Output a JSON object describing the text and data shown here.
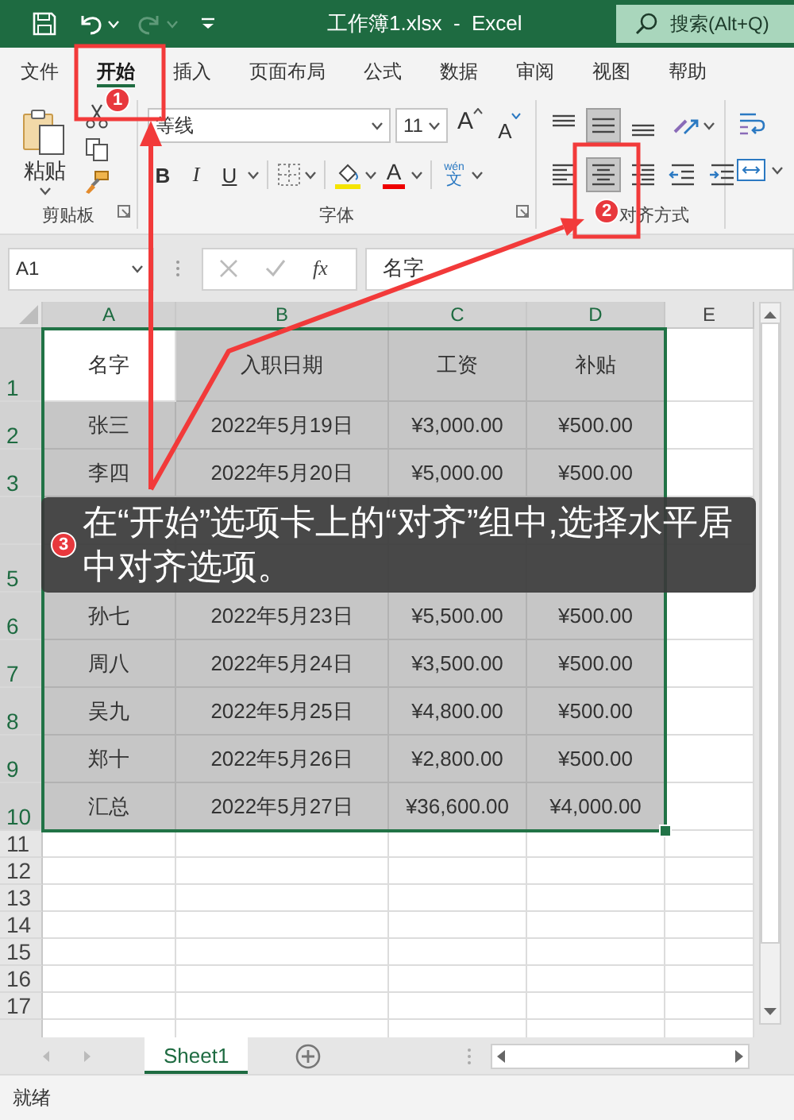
{
  "title_bar": {
    "title": "工作簿1.xlsx  -  Excel",
    "search": {
      "placeholder": "搜索(Alt+Q)"
    }
  },
  "ribbon_tabs": [
    {
      "label": "文件",
      "selected": false
    },
    {
      "label": "开始",
      "selected": true
    },
    {
      "label": "插入",
      "selected": false
    },
    {
      "label": "页面布局",
      "selected": false
    },
    {
      "label": "公式",
      "selected": false
    },
    {
      "label": "数据",
      "selected": false
    },
    {
      "label": "审阅",
      "selected": false
    },
    {
      "label": "视图",
      "selected": false
    },
    {
      "label": "帮助",
      "selected": false
    }
  ],
  "ribbon": {
    "clipboard": {
      "paste_label": "粘贴",
      "group_label": "剪贴板"
    },
    "font": {
      "font_name": "等线",
      "font_size": "11",
      "grow": "A",
      "shrink": "A",
      "bold": "B",
      "italic": "I",
      "underline": "U",
      "font_color": "A",
      "phonetic_pinyin": "wén",
      "phonetic_char": "文",
      "group_label": "字体"
    },
    "alignment": {
      "group_label": "对齐方式",
      "buttons": [
        {
          "kind": "top",
          "selected": false
        },
        {
          "kind": "middle",
          "selected": true
        },
        {
          "kind": "bottom",
          "selected": false
        },
        {
          "kind": "orientation",
          "selected": false
        },
        {
          "kind": "left",
          "selected": false
        },
        {
          "kind": "center",
          "selected": true
        },
        {
          "kind": "right",
          "selected": false
        },
        {
          "kind": "outdent",
          "selected": false
        },
        {
          "kind": "indent",
          "selected": false
        }
      ]
    }
  },
  "formula_bar": {
    "name_box": "A1",
    "function_label": "fx",
    "formula": "名字"
  },
  "sheet": {
    "columns": [
      {
        "label": "A",
        "selected": true
      },
      {
        "label": "B",
        "selected": true
      },
      {
        "label": "C",
        "selected": true
      },
      {
        "label": "D",
        "selected": true
      },
      {
        "label": "E",
        "selected": false
      }
    ],
    "rows": [
      {
        "number": "1",
        "selected": true,
        "cells": [
          {
            "text": "名字",
            "selected": false
          },
          {
            "text": "入职日期",
            "selected": true
          },
          {
            "text": "工资",
            "selected": true
          },
          {
            "text": "补贴",
            "selected": true
          }
        ]
      },
      {
        "number": "2",
        "selected": true,
        "cells": [
          {
            "text": "张三",
            "selected": true
          },
          {
            "text": "2022年5月19日",
            "selected": true
          },
          {
            "text": "¥3,000.00",
            "selected": true
          },
          {
            "text": "¥500.00",
            "selected": true
          }
        ]
      },
      {
        "number": "3",
        "selected": true,
        "cells": [
          {
            "text": "李四",
            "selected": true
          },
          {
            "text": "2022年5月20日",
            "selected": true
          },
          {
            "text": "¥5,000.00",
            "selected": true
          },
          {
            "text": "¥500.00",
            "selected": true
          }
        ]
      },
      {
        "selected": true
      },
      {
        "number": "5",
        "selected": true
      },
      {
        "number": "6",
        "selected": true,
        "cells": [
          {
            "text": "孙七",
            "selected": true
          },
          {
            "text": "2022年5月23日",
            "selected": true
          },
          {
            "text": "¥5,500.00",
            "selected": true
          },
          {
            "text": "¥500.00",
            "selected": true
          }
        ]
      },
      {
        "number": "7",
        "selected": true,
        "cells": [
          {
            "text": "周八",
            "selected": true
          },
          {
            "text": "2022年5月24日",
            "selected": true
          },
          {
            "text": "¥3,500.00",
            "selected": true
          },
          {
            "text": "¥500.00",
            "selected": true
          }
        ]
      },
      {
        "number": "8",
        "selected": true,
        "cells": [
          {
            "text": "吴九",
            "selected": true
          },
          {
            "text": "2022年5月25日",
            "selected": true
          },
          {
            "text": "¥4,800.00",
            "selected": true
          },
          {
            "text": "¥500.00",
            "selected": true
          }
        ]
      },
      {
        "number": "9",
        "selected": true,
        "cells": [
          {
            "text": "郑十",
            "selected": true
          },
          {
            "text": "2022年5月26日",
            "selected": true
          },
          {
            "text": "¥2,800.00",
            "selected": true
          },
          {
            "text": "¥500.00",
            "selected": true
          }
        ]
      },
      {
        "number": "10",
        "selected": true,
        "cells": [
          {
            "text": "汇总",
            "selected": true
          },
          {
            "text": "2022年5月27日",
            "selected": true
          },
          {
            "text": "¥36,600.00",
            "selected": true
          },
          {
            "text": "¥4,000.00",
            "selected": true
          }
        ]
      },
      {
        "number": "11",
        "selected": false
      },
      {
        "number": "12",
        "selected": false
      },
      {
        "number": "13",
        "selected": false
      },
      {
        "number": "14",
        "selected": false
      },
      {
        "number": "15",
        "selected": false
      },
      {
        "number": "16",
        "selected": false
      },
      {
        "number": "17",
        "selected": false
      }
    ]
  },
  "sheet_tabs": [
    {
      "label": "Sheet1",
      "selected": true
    }
  ],
  "status_bar": {
    "text": "就绪"
  },
  "annotations": {
    "badges": [
      "1",
      "2",
      "3"
    ],
    "caption": "在“开始”选项卡上的“对齐”组中,选择水平居中对齐选项。"
  }
}
